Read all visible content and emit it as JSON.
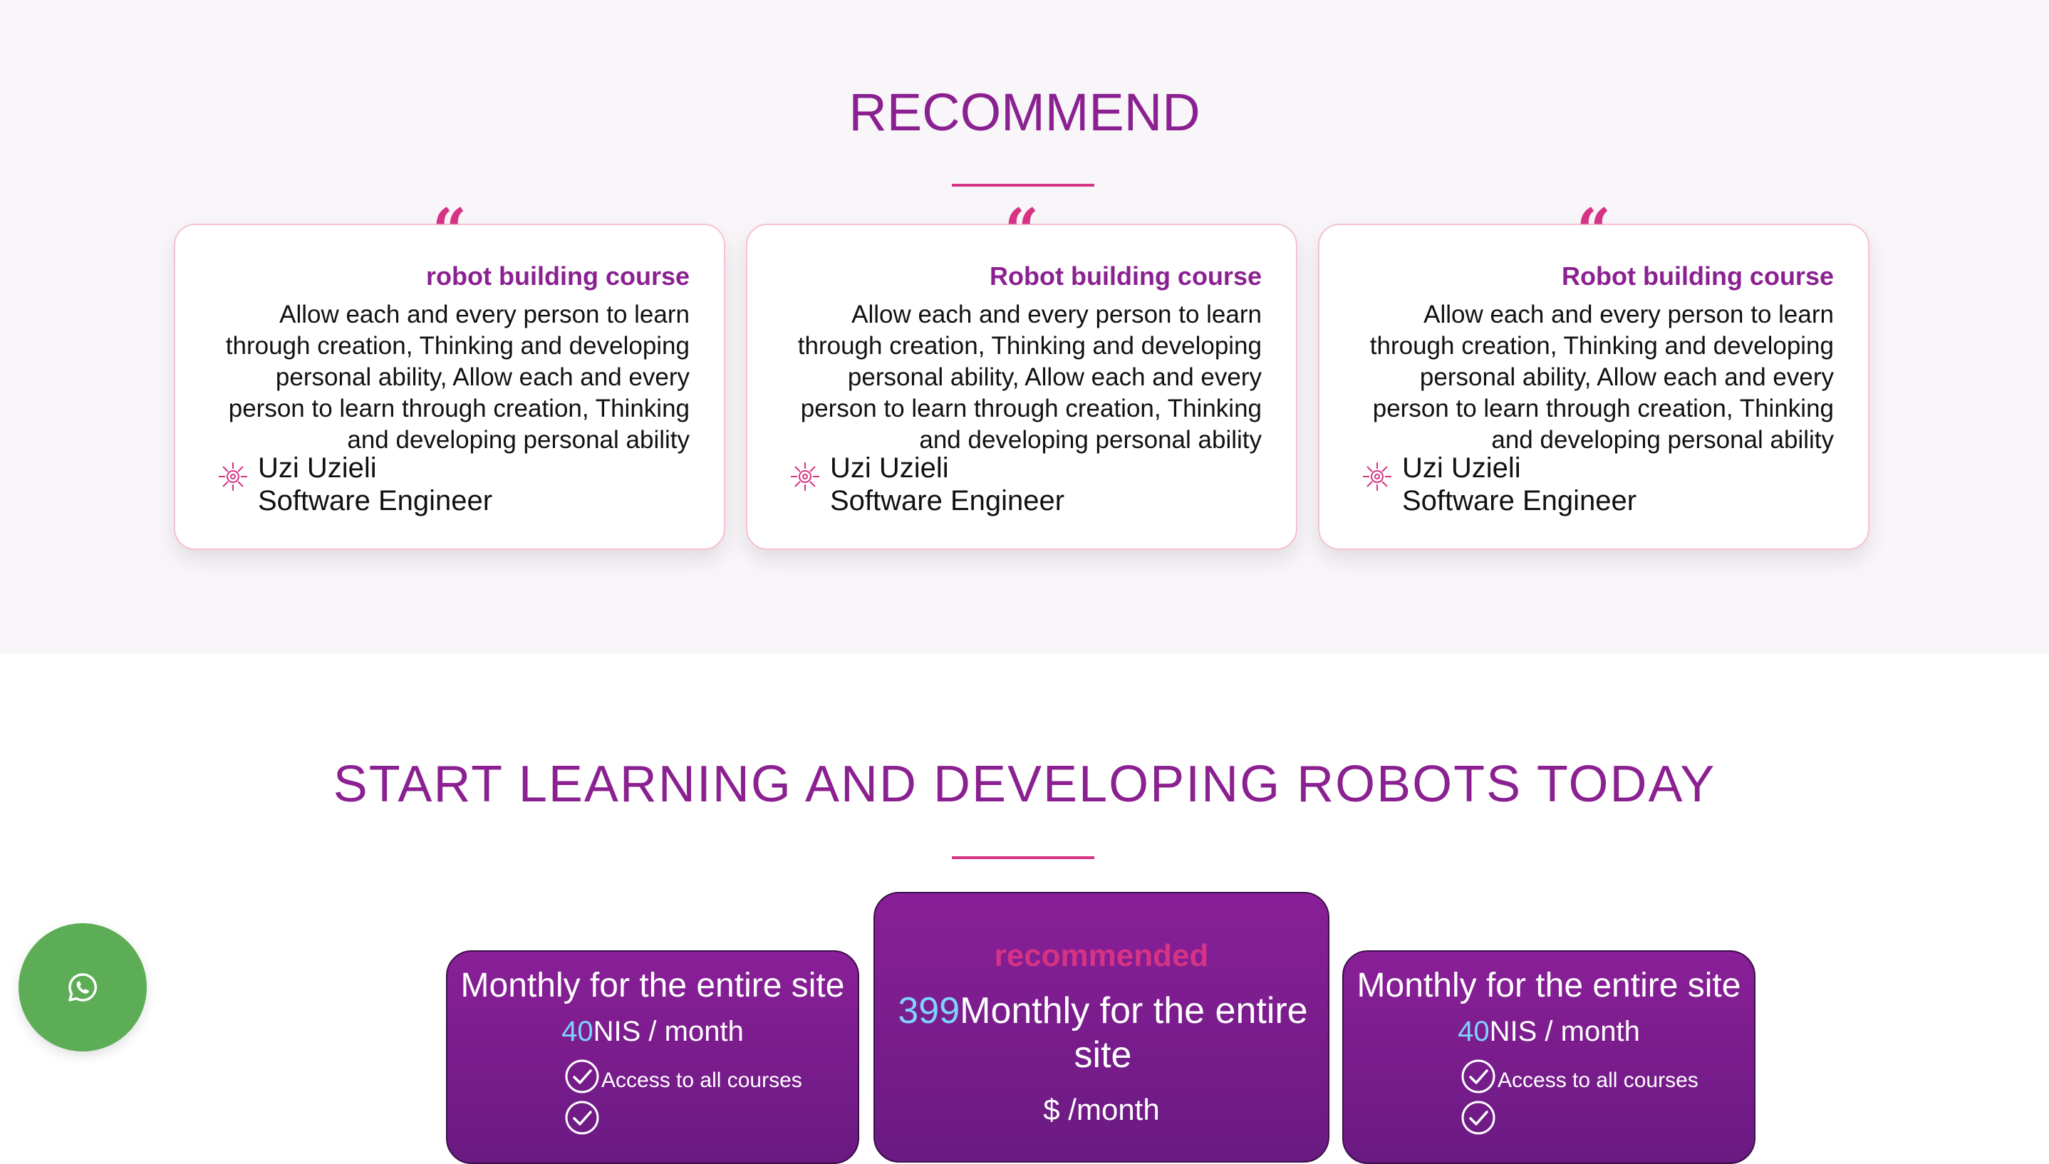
{
  "recommend": {
    "title": "RECOMMEND",
    "cards": [
      {
        "course": "robot building course",
        "text": "Allow each and every person to learn through creation, Thinking and developing personal ability, Allow each and every person to learn through creation, Thinking and developing personal ability",
        "author_name": "Uzi Uzieli",
        "author_role": "Software Engineer"
      },
      {
        "course": "Robot building course",
        "text": "Allow each and every person to learn through creation, Thinking and developing personal ability, Allow each and every person to learn through creation, Thinking and developing personal ability",
        "author_name": "Uzi Uzieli",
        "author_role": "Software Engineer"
      },
      {
        "course": "Robot building course",
        "text": "Allow each and every person to learn through creation, Thinking and developing personal ability, Allow each and every person to learn through creation, Thinking and developing personal ability",
        "author_name": "Uzi Uzieli",
        "author_role": "Software Engineer"
      }
    ]
  },
  "pricing": {
    "title": "START LEARNING AND DEVELOPING ROBOTS TODAY",
    "plans": [
      {
        "name": "Monthly for the entire site",
        "price": "40",
        "unit": "NIS / month",
        "features": [
          "Access to all courses",
          ""
        ]
      },
      {
        "badge": "recommended",
        "price": "399",
        "name": "Monthly for the entire site",
        "unit": "$ /month"
      },
      {
        "name": "Monthly for the entire site",
        "price": "40",
        "unit": "NIS / month",
        "features": [
          "Access to all courses",
          ""
        ]
      }
    ]
  },
  "icons": {
    "quote": "quote-icon",
    "author": "robot-logo-icon",
    "check": "check-circle-icon",
    "whatsapp": "whatsapp-icon"
  },
  "colors": {
    "title": "#8b2191",
    "accent": "#d63384",
    "price_number": "#7dd4ff",
    "card_purple": "#7b1d8e",
    "whatsapp_green": "#5cad55"
  }
}
